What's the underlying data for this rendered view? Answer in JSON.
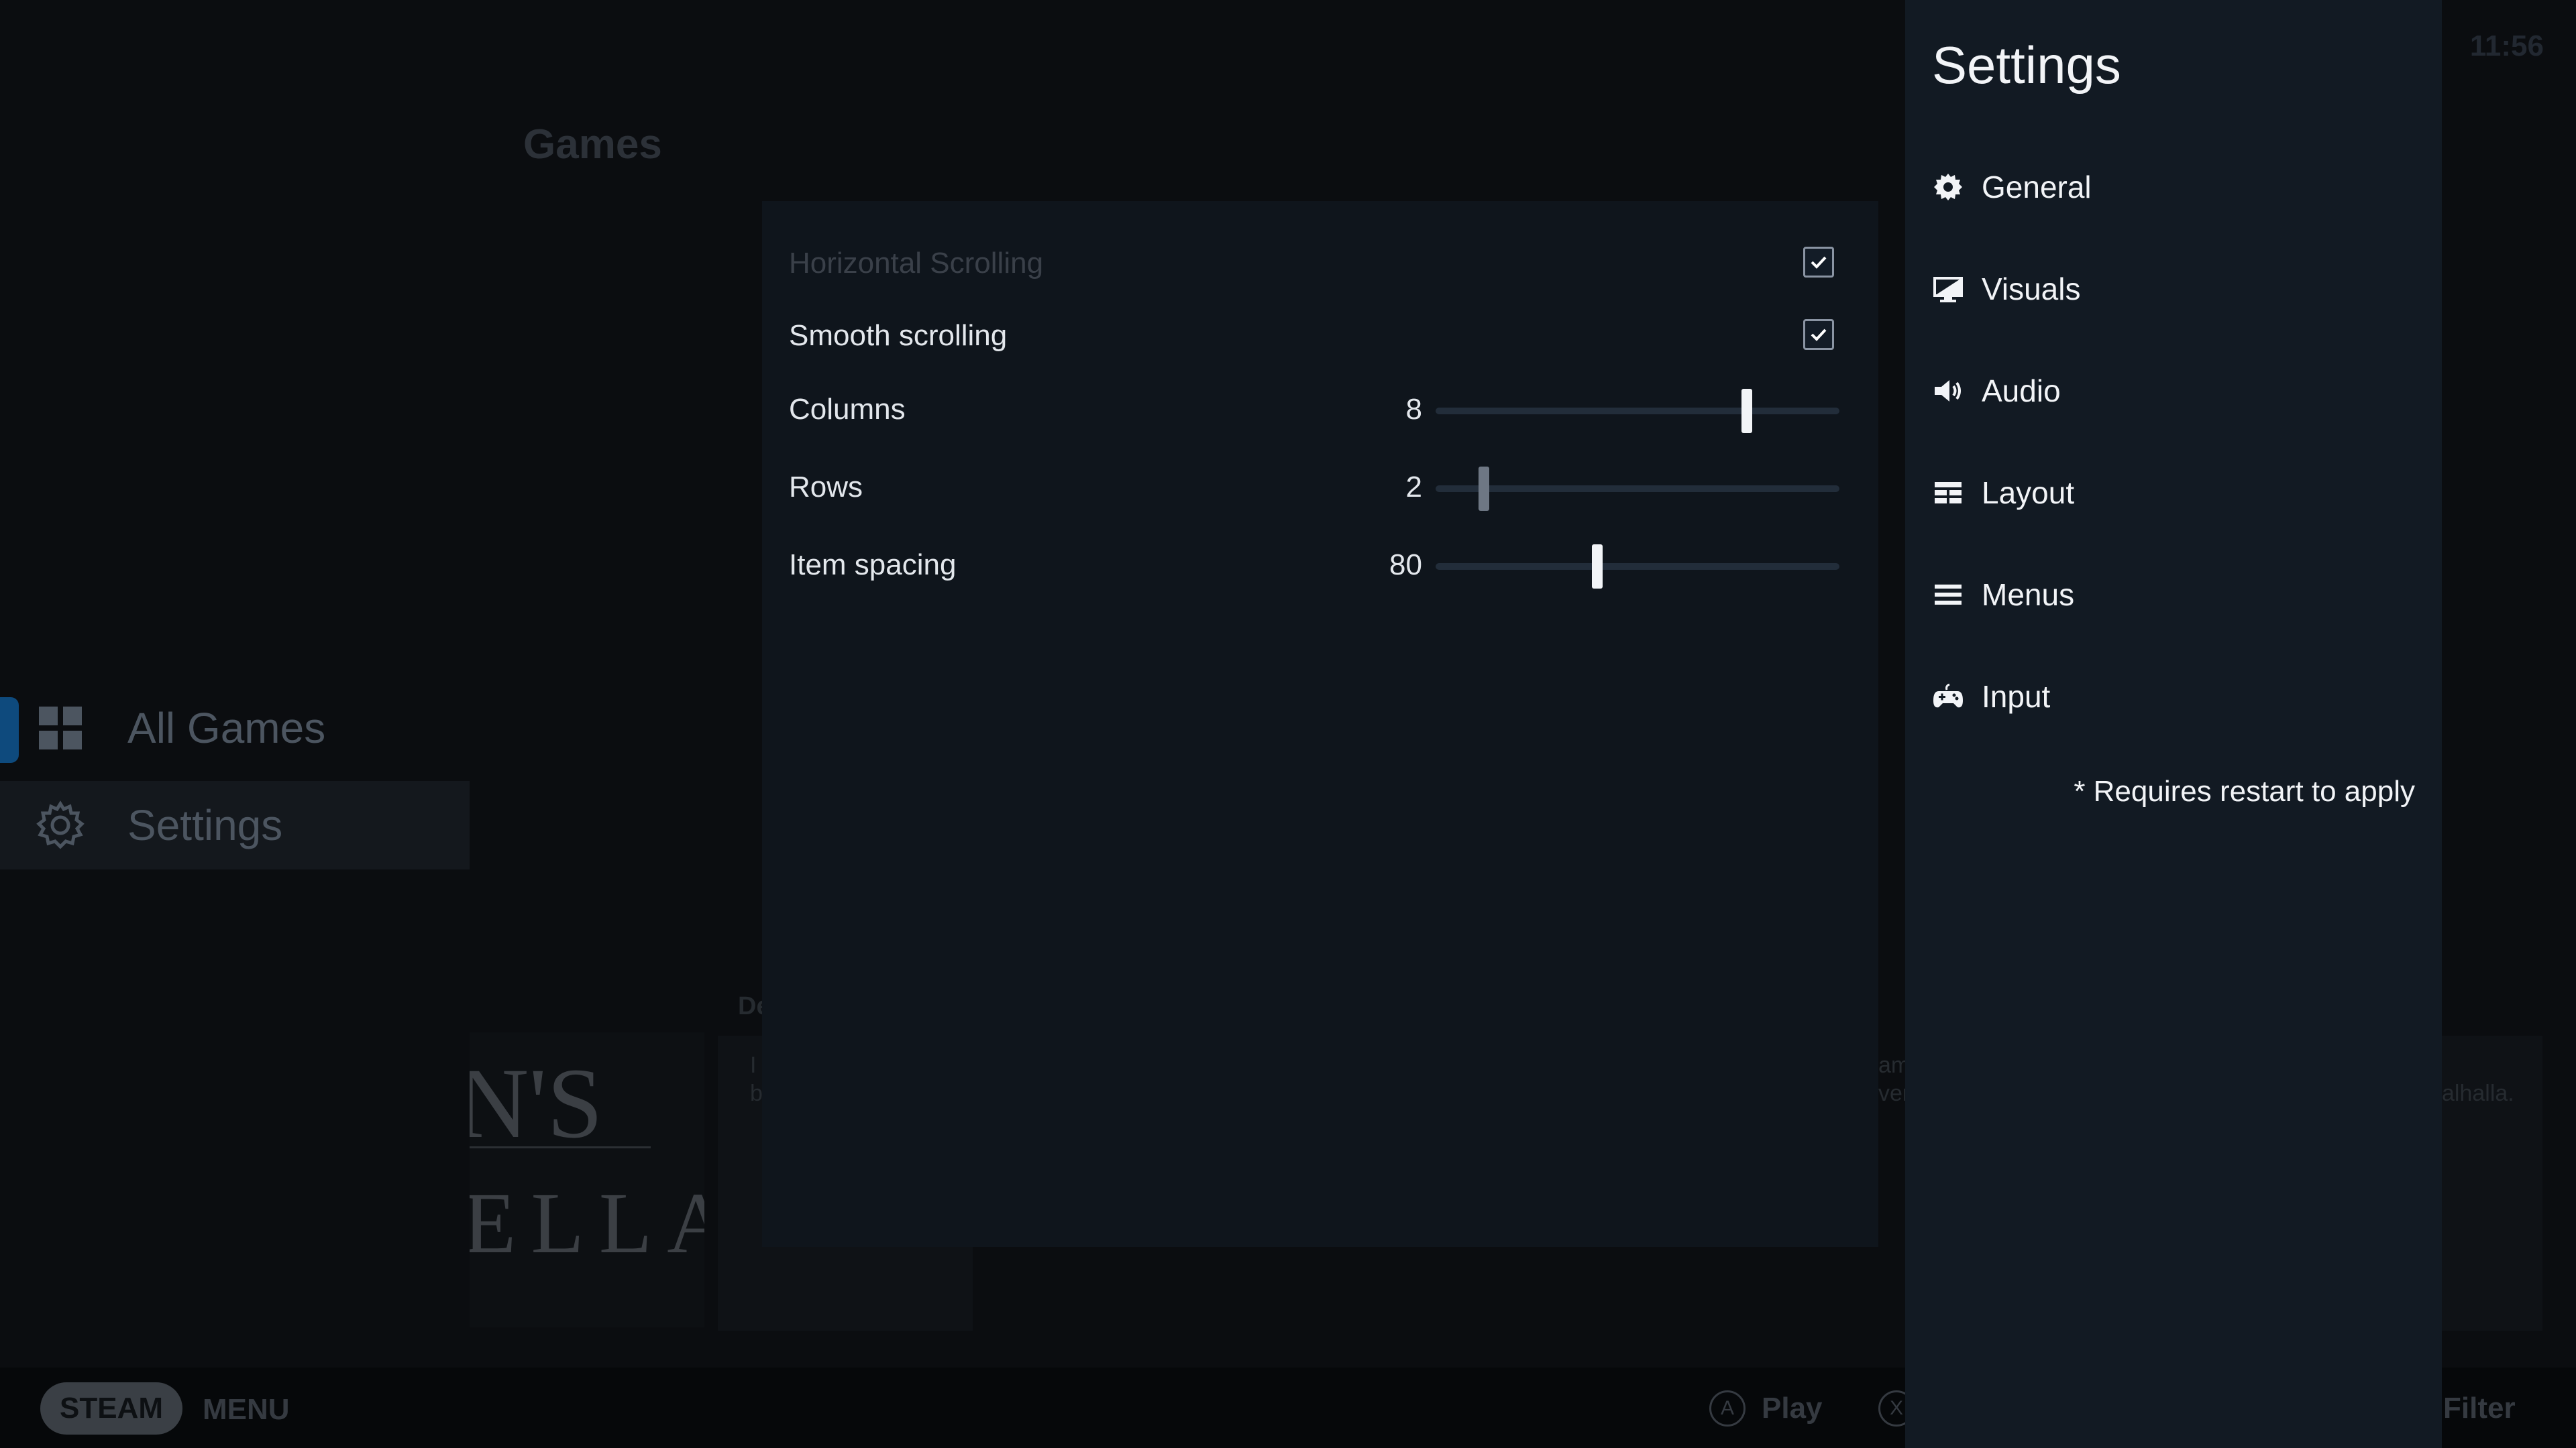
{
  "background": {
    "header_title": "Games",
    "clock": "11:56",
    "side_menu": [
      {
        "label": "All Games",
        "icon": "grid-icon",
        "selected": true
      },
      {
        "label": "Settings",
        "icon": "gear-icon",
        "selected": false
      }
    ],
    "art_text_top": "N'S",
    "art_text_bottom": "ELLA",
    "fragments": [
      "De",
      "I",
      "b",
      "am",
      "ver",
      "alhalla."
    ]
  },
  "dialog": {
    "rows": [
      {
        "type": "checkbox",
        "label": "Horizontal Scrolling",
        "checked": true,
        "disabled": true
      },
      {
        "type": "checkbox",
        "label": "Smooth scrolling",
        "checked": true,
        "disabled": false
      },
      {
        "type": "slider",
        "label": "Columns",
        "value": "8",
        "position": 0.77
      },
      {
        "type": "slider",
        "label": "Rows",
        "value": "2",
        "position": 0.12
      },
      {
        "type": "slider",
        "label": "Item spacing",
        "value": "80",
        "position": 0.4
      }
    ]
  },
  "panel": {
    "title": "Settings",
    "nav": [
      {
        "label": "General",
        "icon": "gear-icon"
      },
      {
        "label": "Visuals",
        "icon": "monitor-icon"
      },
      {
        "label": "Audio",
        "icon": "speaker-icon"
      },
      {
        "label": "Layout",
        "icon": "layout-grid-icon"
      },
      {
        "label": "Menus",
        "icon": "menu-icon"
      },
      {
        "label": "Input",
        "icon": "gamepad-icon"
      }
    ],
    "restart_note": "* Requires restart to apply"
  },
  "bottom_bar": {
    "steam_label": "STEAM",
    "menu_label": "MENU",
    "hint_a_glyph": "A",
    "hint_a_label": "Play",
    "hint_x_glyph": "X",
    "hint_filter_label": "Filter"
  },
  "colors": {
    "dialog_bg": "#0f151c",
    "panel_bg": "#121a23",
    "text": "#e3e7ec",
    "accent": "#0e4a7d"
  }
}
